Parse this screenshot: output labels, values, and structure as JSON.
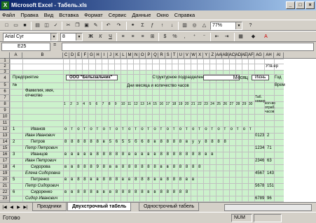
{
  "window": {
    "title": "Microsoft Excel - Табель.xls",
    "app_icon": "excel-icon",
    "controls": [
      "_",
      "□",
      "×"
    ]
  },
  "menu": [
    "Файл",
    "Правка",
    "Вид",
    "Вставка",
    "Формат",
    "Сервис",
    "Данные",
    "Окно",
    "Справка"
  ],
  "toolbar": {
    "zoom": "77%",
    "font_name": "Arial Cyr",
    "font_size": "8"
  },
  "formula_bar": {
    "cell_ref": "E25",
    "fx": "="
  },
  "columns": [
    "A",
    "B",
    "C",
    "D",
    "E",
    "F",
    "G",
    "H",
    "I",
    "J",
    "K",
    "L",
    "M",
    "N",
    "O",
    "P",
    "Q",
    "R",
    "S",
    "T",
    "U",
    "V",
    "W",
    "X",
    "Y",
    "Z",
    "AA",
    "AB",
    "AC",
    "AD",
    "AE",
    "AF",
    "AG",
    "AH",
    "AI"
  ],
  "rows": [
    "1",
    "2",
    "3",
    "4",
    "5",
    "6",
    "7",
    "8",
    "9",
    "10",
    "11",
    "12",
    "13",
    "14",
    "15",
    "16",
    "17",
    "18",
    "19",
    "20",
    "21",
    "22",
    "23",
    "24",
    "25"
  ],
  "sheet": {
    "top_right": "Утв.ер",
    "org_label": "Предприятие",
    "org_value": "ООО \"Белызальчик\"",
    "dept_label": "Структурное подразделение",
    "month_label": "Месяц",
    "month_value": "Июнь",
    "year_label": "Год",
    "col_num_header": "№",
    "fio_header": "Фамилия, имя, отчество",
    "days_header": "Дни месяца и количество часов",
    "tab_header": "Таб. номер",
    "right_header": "Врем",
    "sub_header": "кол-во отраб. часов",
    "days": [
      "1",
      "2",
      "3",
      "4",
      "5",
      "6",
      "7",
      "8",
      "9",
      "10",
      "11",
      "12",
      "13",
      "14",
      "15",
      "16",
      "17",
      "18",
      "19",
      "20",
      "21",
      "22",
      "23",
      "24",
      "25",
      "26",
      "27",
      "28",
      "29",
      "30",
      "31"
    ],
    "employees": [
      {
        "num": "1",
        "last": "Иванов",
        "first": "Иван Иванович",
        "marks": "о т о т о т о т о т о т о т о т о т о т о т о т о т о т о т",
        "tab": "0123",
        "hours": "2"
      },
      {
        "num": "2",
        "last": "Петров",
        "first": "Петр Петрович",
        "marks": "8 8 8 8 8 8 в 5 6 5 5 б 6 8 в 8 8 8 8 в у у 8 8 8 8",
        "tab": "1234",
        "hours": "71"
      },
      {
        "num": "3",
        "last": "Иванцов",
        "first": "Иван Петрович",
        "marks": "в в в в в 8 8 8 8 8 в в в в в 8 8 8 8 8 8 8 в в",
        "tab": "2346",
        "hours": "63"
      },
      {
        "num": "4",
        "last": "Сидорова",
        "first": "Елена Сидоровна",
        "marks": "в в 8 8 8 9 8 в в 8 8 8 8 8 8 в в 8 8 8 8 8",
        "tab": "4567",
        "hours": "143"
      },
      {
        "num": "5",
        "last": "Петренко",
        "first": "Петр Сидорович",
        "marks": "в в 8 8 в в 8 8 8 в в 8 8 8 в в 8 8 8 в в",
        "tab": "5678",
        "hours": "151"
      },
      {
        "num": "6",
        "last": "Сидоренко",
        "first": "Сидор Иванович",
        "marks": "в в 8 8 8 в в в 8 8 8 8 8 в в 8 8 8 8 8",
        "tab": "6789",
        "hours": "96"
      }
    ]
  },
  "sheet_tabs": [
    "Праздники",
    "Двухстрочный табель",
    "Однострочный табель"
  ],
  "active_tab": 1,
  "status": {
    "text": "Готово",
    "num": "NUM"
  }
}
